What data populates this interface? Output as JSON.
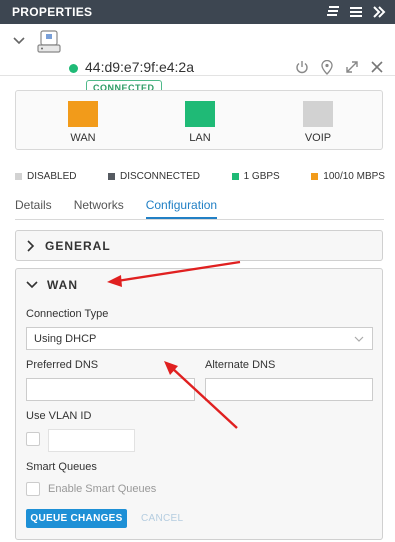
{
  "header": {
    "title": "PROPERTIES"
  },
  "device": {
    "mac": "44:d9:e7:9f:e4:2a",
    "status": "CONNECTED"
  },
  "ports": [
    {
      "label": "WAN",
      "color": "#f29b1a"
    },
    {
      "label": "LAN",
      "color": "#1fba76"
    },
    {
      "label": "VOIP",
      "color": "#d2d2d2"
    }
  ],
  "legend": [
    {
      "label": "DISABLED",
      "color": "#d2d2d2"
    },
    {
      "label": "DISCONNECTED",
      "color": "#555a61"
    },
    {
      "label": "1 GBPS",
      "color": "#1fba76"
    },
    {
      "label": "100/10 MBPS",
      "color": "#f29b1a"
    }
  ],
  "tabs": [
    {
      "label": "Details"
    },
    {
      "label": "Networks"
    },
    {
      "label": "Configuration",
      "active": true
    }
  ],
  "general": {
    "title": "GENERAL"
  },
  "wan": {
    "title": "WAN",
    "connection_type_label": "Connection Type",
    "connection_type_value": "Using DHCP",
    "preferred_dns_label": "Preferred DNS",
    "alternate_dns_label": "Alternate DNS",
    "vlan_label": "Use VLAN ID",
    "smart_queues_label": "Smart Queues",
    "enable_smart_queues_label": "Enable Smart Queues",
    "queue_changes_label": "QUEUE CHANGES",
    "cancel_label": "CANCEL"
  },
  "colors": {
    "accent": "#2280c5",
    "arrow": "#e02020",
    "titlebar": "#3d4651"
  }
}
